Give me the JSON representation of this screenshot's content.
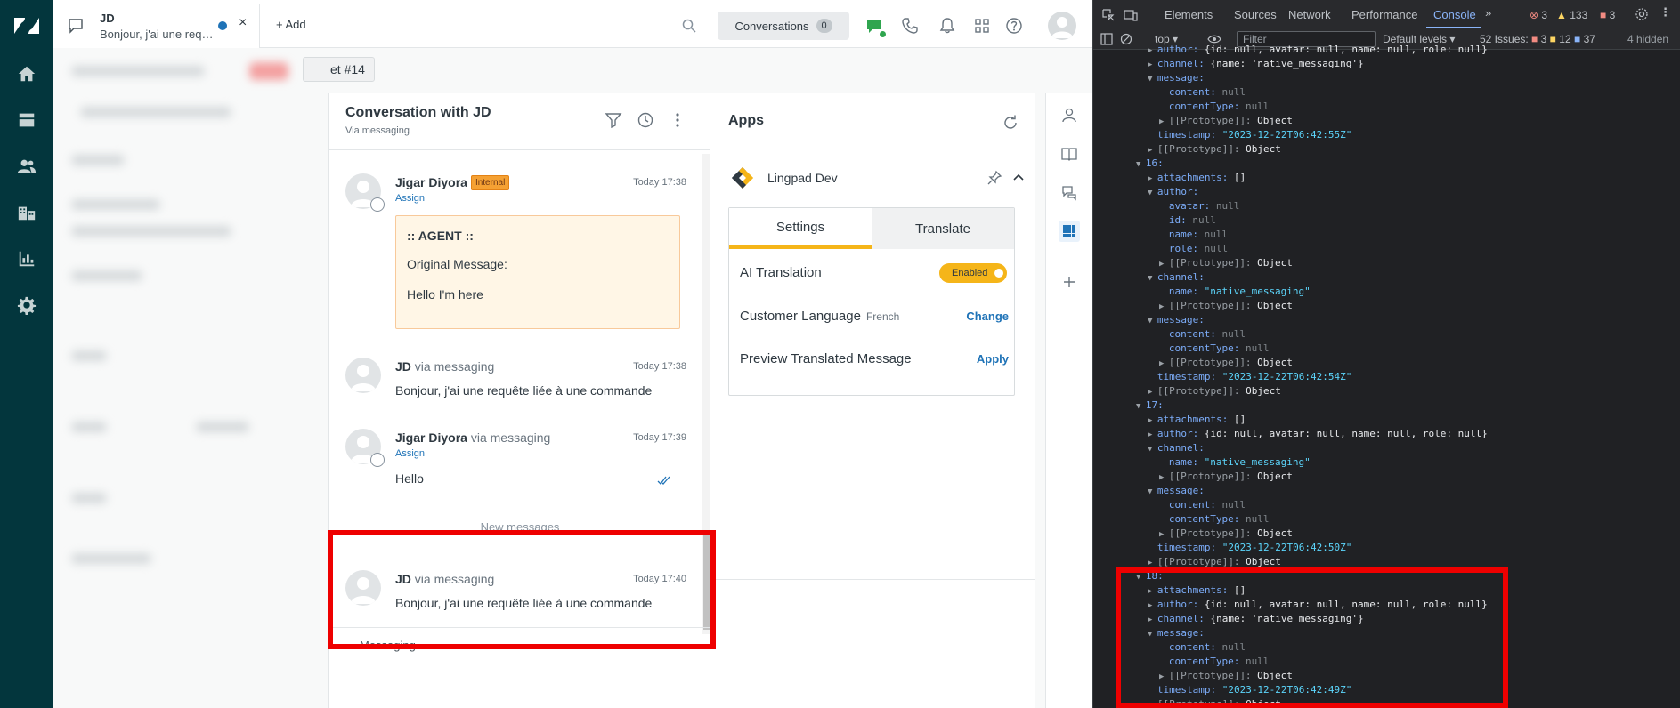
{
  "rail": {
    "items": [
      "logo-icon",
      "home-icon",
      "views-icon",
      "customers-icon",
      "organizations-icon",
      "reporting-icon",
      "admin-icon"
    ]
  },
  "topbar": {
    "tab_title": "JD",
    "tab_subtitle": "Bonjour, j'ai une requête liée à une commande",
    "tab_close": "×",
    "add_label": "+ Add",
    "conversations_label": "Conversations",
    "conversations_count": "0"
  },
  "ticket_bar": {
    "chip": "et #14"
  },
  "conversation": {
    "title": "Conversation with JD",
    "subtitle": "Via messaging",
    "messages": [
      {
        "author": "Jigar Diyora",
        "via": "",
        "badge": "Internal",
        "time": "Today 17:38",
        "assign": "Assign",
        "note": [
          ":: AGENT ::",
          "Original Message:",
          "Hello I'm here"
        ]
      },
      {
        "author": "JD",
        "via": "via messaging",
        "time": "Today 17:38",
        "body": "Bonjour, j'ai une requête liée à une commande"
      },
      {
        "author": "Jigar Diyora",
        "via": "via messaging",
        "time": "Today 17:39",
        "assign": "Assign",
        "body": "Hello"
      },
      {
        "author": "JD",
        "via": "via messaging",
        "time": "Today 17:40",
        "body": "Bonjour, j'ai une requête liée à une commande"
      }
    ],
    "new_messages": "New messages",
    "composer_label": "Messaging"
  },
  "apps": {
    "title": "Apps",
    "app_name": "Lingpad Dev",
    "tabs": [
      "Settings",
      "Translate"
    ],
    "rows": {
      "ai_translation": {
        "label": "AI Translation",
        "toggle": "Enabled"
      },
      "customer_language": {
        "label": "Customer Language",
        "value": "French",
        "action": "Change"
      },
      "preview": {
        "label": "Preview Translated Message",
        "action": "Apply"
      }
    }
  },
  "devtools": {
    "tabs": [
      "Elements",
      "Sources",
      "Network",
      "Performance",
      "Console"
    ],
    "active_tab": "Console",
    "errors": "3",
    "warnings": "133",
    "issues_badge": "3",
    "context": "top",
    "filter_placeholder": "Filter",
    "levels": "Default levels",
    "issues_label": "52 Issues:",
    "issues_err": "3",
    "issues_warn": "12",
    "issues_info": "37",
    "hidden": "4 hidden",
    "lines": [
      {
        "i": 8,
        "t": "▶",
        "k": "author",
        "v": "{id: null, avatar: null, name: null, role: null}"
      },
      {
        "i": 8,
        "t": "▶",
        "k": "channel",
        "v": "{name: 'native_messaging'}"
      },
      {
        "i": 8,
        "t": "▼",
        "k": "message",
        "v": ""
      },
      {
        "i": 10,
        "t": "",
        "k": "content",
        "v": "null"
      },
      {
        "i": 10,
        "t": "",
        "k": "contentType",
        "v": "null"
      },
      {
        "i": 10,
        "t": "▶",
        "k": "[[Prototype]]",
        "v": "Object"
      },
      {
        "i": 8,
        "t": "",
        "k": "timestamp",
        "v": "\"2023-12-22T06:42:55Z\""
      },
      {
        "i": 8,
        "t": "▶",
        "k": "[[Prototype]]",
        "v": "Object"
      },
      {
        "i": 6,
        "t": "▼",
        "k": "16",
        "v": ""
      },
      {
        "i": 8,
        "t": "▶",
        "k": "attachments",
        "v": "[]"
      },
      {
        "i": 8,
        "t": "▼",
        "k": "author",
        "v": ""
      },
      {
        "i": 10,
        "t": "",
        "k": "avatar",
        "v": "null"
      },
      {
        "i": 10,
        "t": "",
        "k": "id",
        "v": "null"
      },
      {
        "i": 10,
        "t": "",
        "k": "name",
        "v": "null"
      },
      {
        "i": 10,
        "t": "",
        "k": "role",
        "v": "null"
      },
      {
        "i": 10,
        "t": "▶",
        "k": "[[Prototype]]",
        "v": "Object"
      },
      {
        "i": 8,
        "t": "▼",
        "k": "channel",
        "v": ""
      },
      {
        "i": 10,
        "t": "",
        "k": "name",
        "v": "\"native_messaging\""
      },
      {
        "i": 10,
        "t": "▶",
        "k": "[[Prototype]]",
        "v": "Object"
      },
      {
        "i": 8,
        "t": "▼",
        "k": "message",
        "v": ""
      },
      {
        "i": 10,
        "t": "",
        "k": "content",
        "v": "null"
      },
      {
        "i": 10,
        "t": "",
        "k": "contentType",
        "v": "null"
      },
      {
        "i": 10,
        "t": "▶",
        "k": "[[Prototype]]",
        "v": "Object"
      },
      {
        "i": 8,
        "t": "",
        "k": "timestamp",
        "v": "\"2023-12-22T06:42:54Z\""
      },
      {
        "i": 8,
        "t": "▶",
        "k": "[[Prototype]]",
        "v": "Object"
      },
      {
        "i": 6,
        "t": "▼",
        "k": "17",
        "v": ""
      },
      {
        "i": 8,
        "t": "▶",
        "k": "attachments",
        "v": "[]"
      },
      {
        "i": 8,
        "t": "▶",
        "k": "author",
        "v": "{id: null, avatar: null, name: null, role: null}"
      },
      {
        "i": 8,
        "t": "▼",
        "k": "channel",
        "v": ""
      },
      {
        "i": 10,
        "t": "",
        "k": "name",
        "v": "\"native_messaging\""
      },
      {
        "i": 10,
        "t": "▶",
        "k": "[[Prototype]]",
        "v": "Object"
      },
      {
        "i": 8,
        "t": "▼",
        "k": "message",
        "v": ""
      },
      {
        "i": 10,
        "t": "",
        "k": "content",
        "v": "null"
      },
      {
        "i": 10,
        "t": "",
        "k": "contentType",
        "v": "null"
      },
      {
        "i": 10,
        "t": "▶",
        "k": "[[Prototype]]",
        "v": "Object"
      },
      {
        "i": 8,
        "t": "",
        "k": "timestamp",
        "v": "\"2023-12-22T06:42:50Z\""
      },
      {
        "i": 8,
        "t": "▶",
        "k": "[[Prototype]]",
        "v": "Object"
      },
      {
        "i": 6,
        "t": "▼",
        "k": "18",
        "v": ""
      },
      {
        "i": 8,
        "t": "▶",
        "k": "attachments",
        "v": "[]"
      },
      {
        "i": 8,
        "t": "▶",
        "k": "author",
        "v": "{id: null, avatar: null, name: null, role: null}"
      },
      {
        "i": 8,
        "t": "▶",
        "k": "channel",
        "v": "{name: 'native_messaging'}"
      },
      {
        "i": 8,
        "t": "▼",
        "k": "message",
        "v": ""
      },
      {
        "i": 10,
        "t": "",
        "k": "content",
        "v": "null"
      },
      {
        "i": 10,
        "t": "",
        "k": "contentType",
        "v": "null"
      },
      {
        "i": 10,
        "t": "▶",
        "k": "[[Prototype]]",
        "v": "Object"
      },
      {
        "i": 8,
        "t": "",
        "k": "timestamp",
        "v": "\"2023-12-22T06:42:49Z\""
      },
      {
        "i": 8,
        "t": "▶",
        "k": "[[Prototype]]",
        "v": "Object"
      }
    ]
  },
  "colors": {
    "rail": "#03363d",
    "highlight": "#ee0000",
    "accent_yellow": "#f5b519",
    "link_blue": "#1f73b7",
    "devtools_bg": "#202124"
  }
}
